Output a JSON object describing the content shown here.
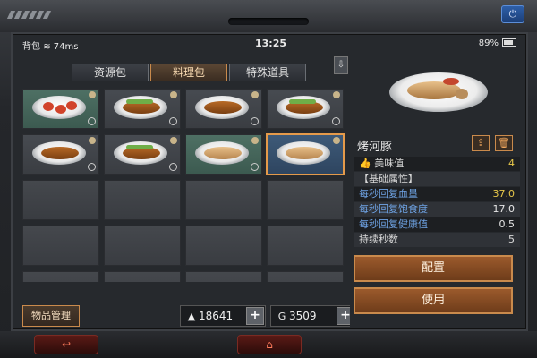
{
  "status_bar": {
    "app": "背包",
    "signal": "74ms",
    "time": "13:25",
    "battery": "89%"
  },
  "tabs": [
    {
      "label": "资源包",
      "active": false
    },
    {
      "label": "料理包",
      "active": true
    },
    {
      "label": "特殊道具",
      "active": false
    }
  ],
  "grid_items": [
    {
      "kind": "salad",
      "bg": "green"
    },
    {
      "kind": "fish",
      "bg": "gray"
    },
    {
      "kind": "fish",
      "bg": "gray"
    },
    {
      "kind": "fish",
      "bg": "gray"
    },
    {
      "kind": "fish",
      "bg": "gray"
    },
    {
      "kind": "fish",
      "bg": "gray"
    },
    {
      "kind": "pork",
      "bg": "green"
    },
    {
      "kind": "pork",
      "bg": "selected"
    }
  ],
  "bottom": {
    "manage_label": "物品管理",
    "currency1": "18641",
    "currency2": "3509"
  },
  "detail": {
    "name": "烤河豚",
    "rows": [
      {
        "label": "美味值",
        "value": "4"
      },
      {
        "label": "【基础属性】",
        "value": ""
      },
      {
        "label": "每秒回复血量",
        "value": "37.0"
      },
      {
        "label": "每秒回复饱食度",
        "value": "17.0"
      },
      {
        "label": "每秒回复健康值",
        "value": "0.5"
      },
      {
        "label": "持续秒数",
        "value": "5"
      }
    ],
    "configure_label": "配置",
    "use_label": "使用"
  },
  "colors": {
    "accent": "#c98a4c",
    "stat_blue": "#6fa4e6",
    "value_yellow": "#e8c84a"
  }
}
